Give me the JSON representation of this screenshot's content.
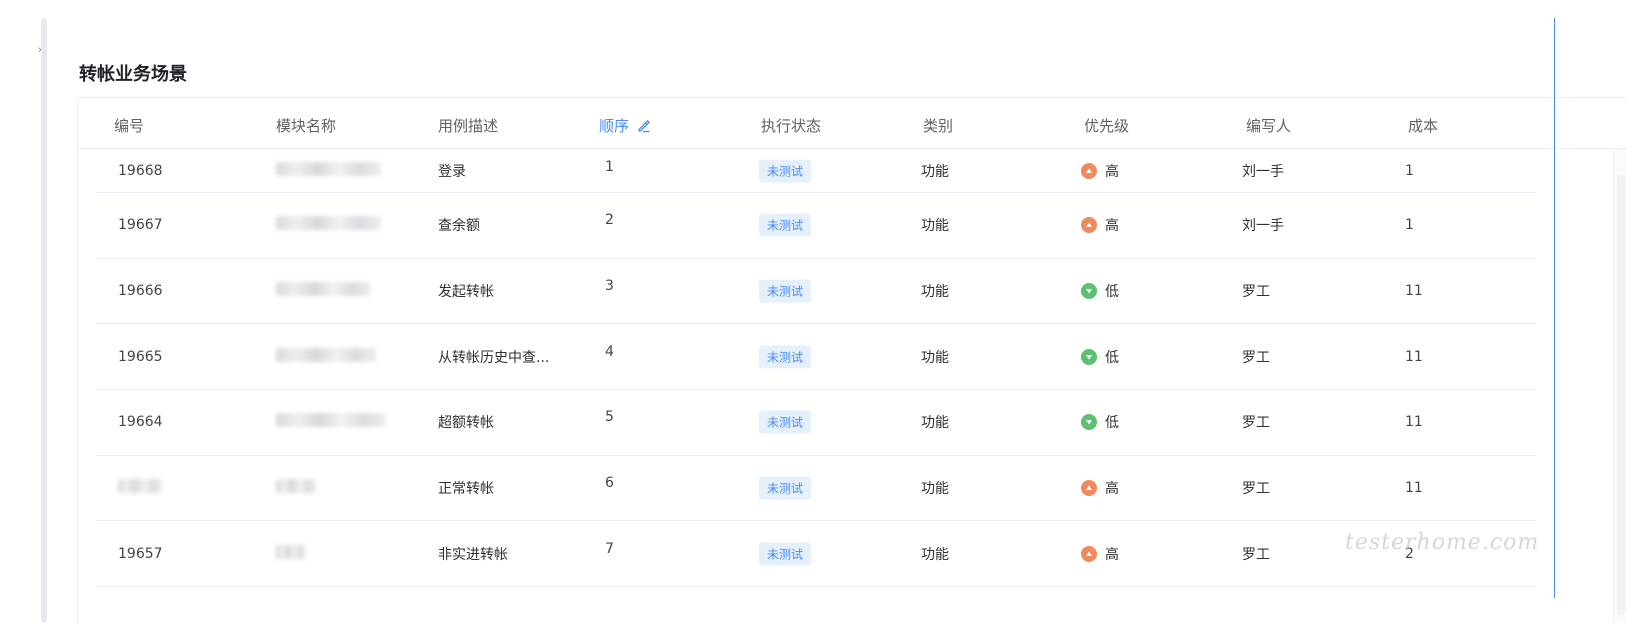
{
  "card": {
    "title": "转帐业务场景"
  },
  "table": {
    "columns": [
      {
        "key": "id",
        "label": "编号"
      },
      {
        "key": "module",
        "label": "模块名称"
      },
      {
        "key": "desc",
        "label": "用例描述"
      },
      {
        "key": "order",
        "label": "顺序"
      },
      {
        "key": "status",
        "label": "执行状态"
      },
      {
        "key": "type",
        "label": "类别"
      },
      {
        "key": "priority",
        "label": "优先级"
      },
      {
        "key": "author",
        "label": "编写人"
      },
      {
        "key": "cost",
        "label": "成本"
      }
    ],
    "rows": [
      {
        "id": "19668",
        "module": "",
        "desc": "登录",
        "order": "1",
        "status": "未测试",
        "type": "功能",
        "priority": "高",
        "author": "刘一手",
        "cost": "1"
      },
      {
        "id": "19667",
        "module": "",
        "desc": "查余额",
        "order": "2",
        "status": "未测试",
        "type": "功能",
        "priority": "高",
        "author": "刘一手",
        "cost": "1"
      },
      {
        "id": "19666",
        "module": "",
        "desc": "发起转帐",
        "order": "3",
        "status": "未测试",
        "type": "功能",
        "priority": "低",
        "author": "罗工",
        "cost": "11"
      },
      {
        "id": "19665",
        "module": "",
        "desc": "从转帐历史中查...",
        "order": "4",
        "status": "未测试",
        "type": "功能",
        "priority": "低",
        "author": "罗工",
        "cost": "11"
      },
      {
        "id": "19664",
        "module": "",
        "desc": "超额转帐",
        "order": "5",
        "status": "未测试",
        "type": "功能",
        "priority": "低",
        "author": "罗工",
        "cost": "11"
      },
      {
        "id": "",
        "module": "",
        "desc": "正常转帐",
        "order": "6",
        "status": "未测试",
        "type": "功能",
        "priority": "高",
        "author": "罗工",
        "cost": "11"
      },
      {
        "id": "19657",
        "module": "",
        "desc": "非实进转帐",
        "order": "7",
        "status": "未测试",
        "type": "功能",
        "priority": "高",
        "author": "罗工",
        "cost": "2"
      }
    ]
  },
  "colors": {
    "accent": "#4a8cf0",
    "high": "#f08a5d",
    "low": "#5cbf72",
    "tag_bg": "#e6f0fd"
  },
  "watermark": "testerhome.com"
}
